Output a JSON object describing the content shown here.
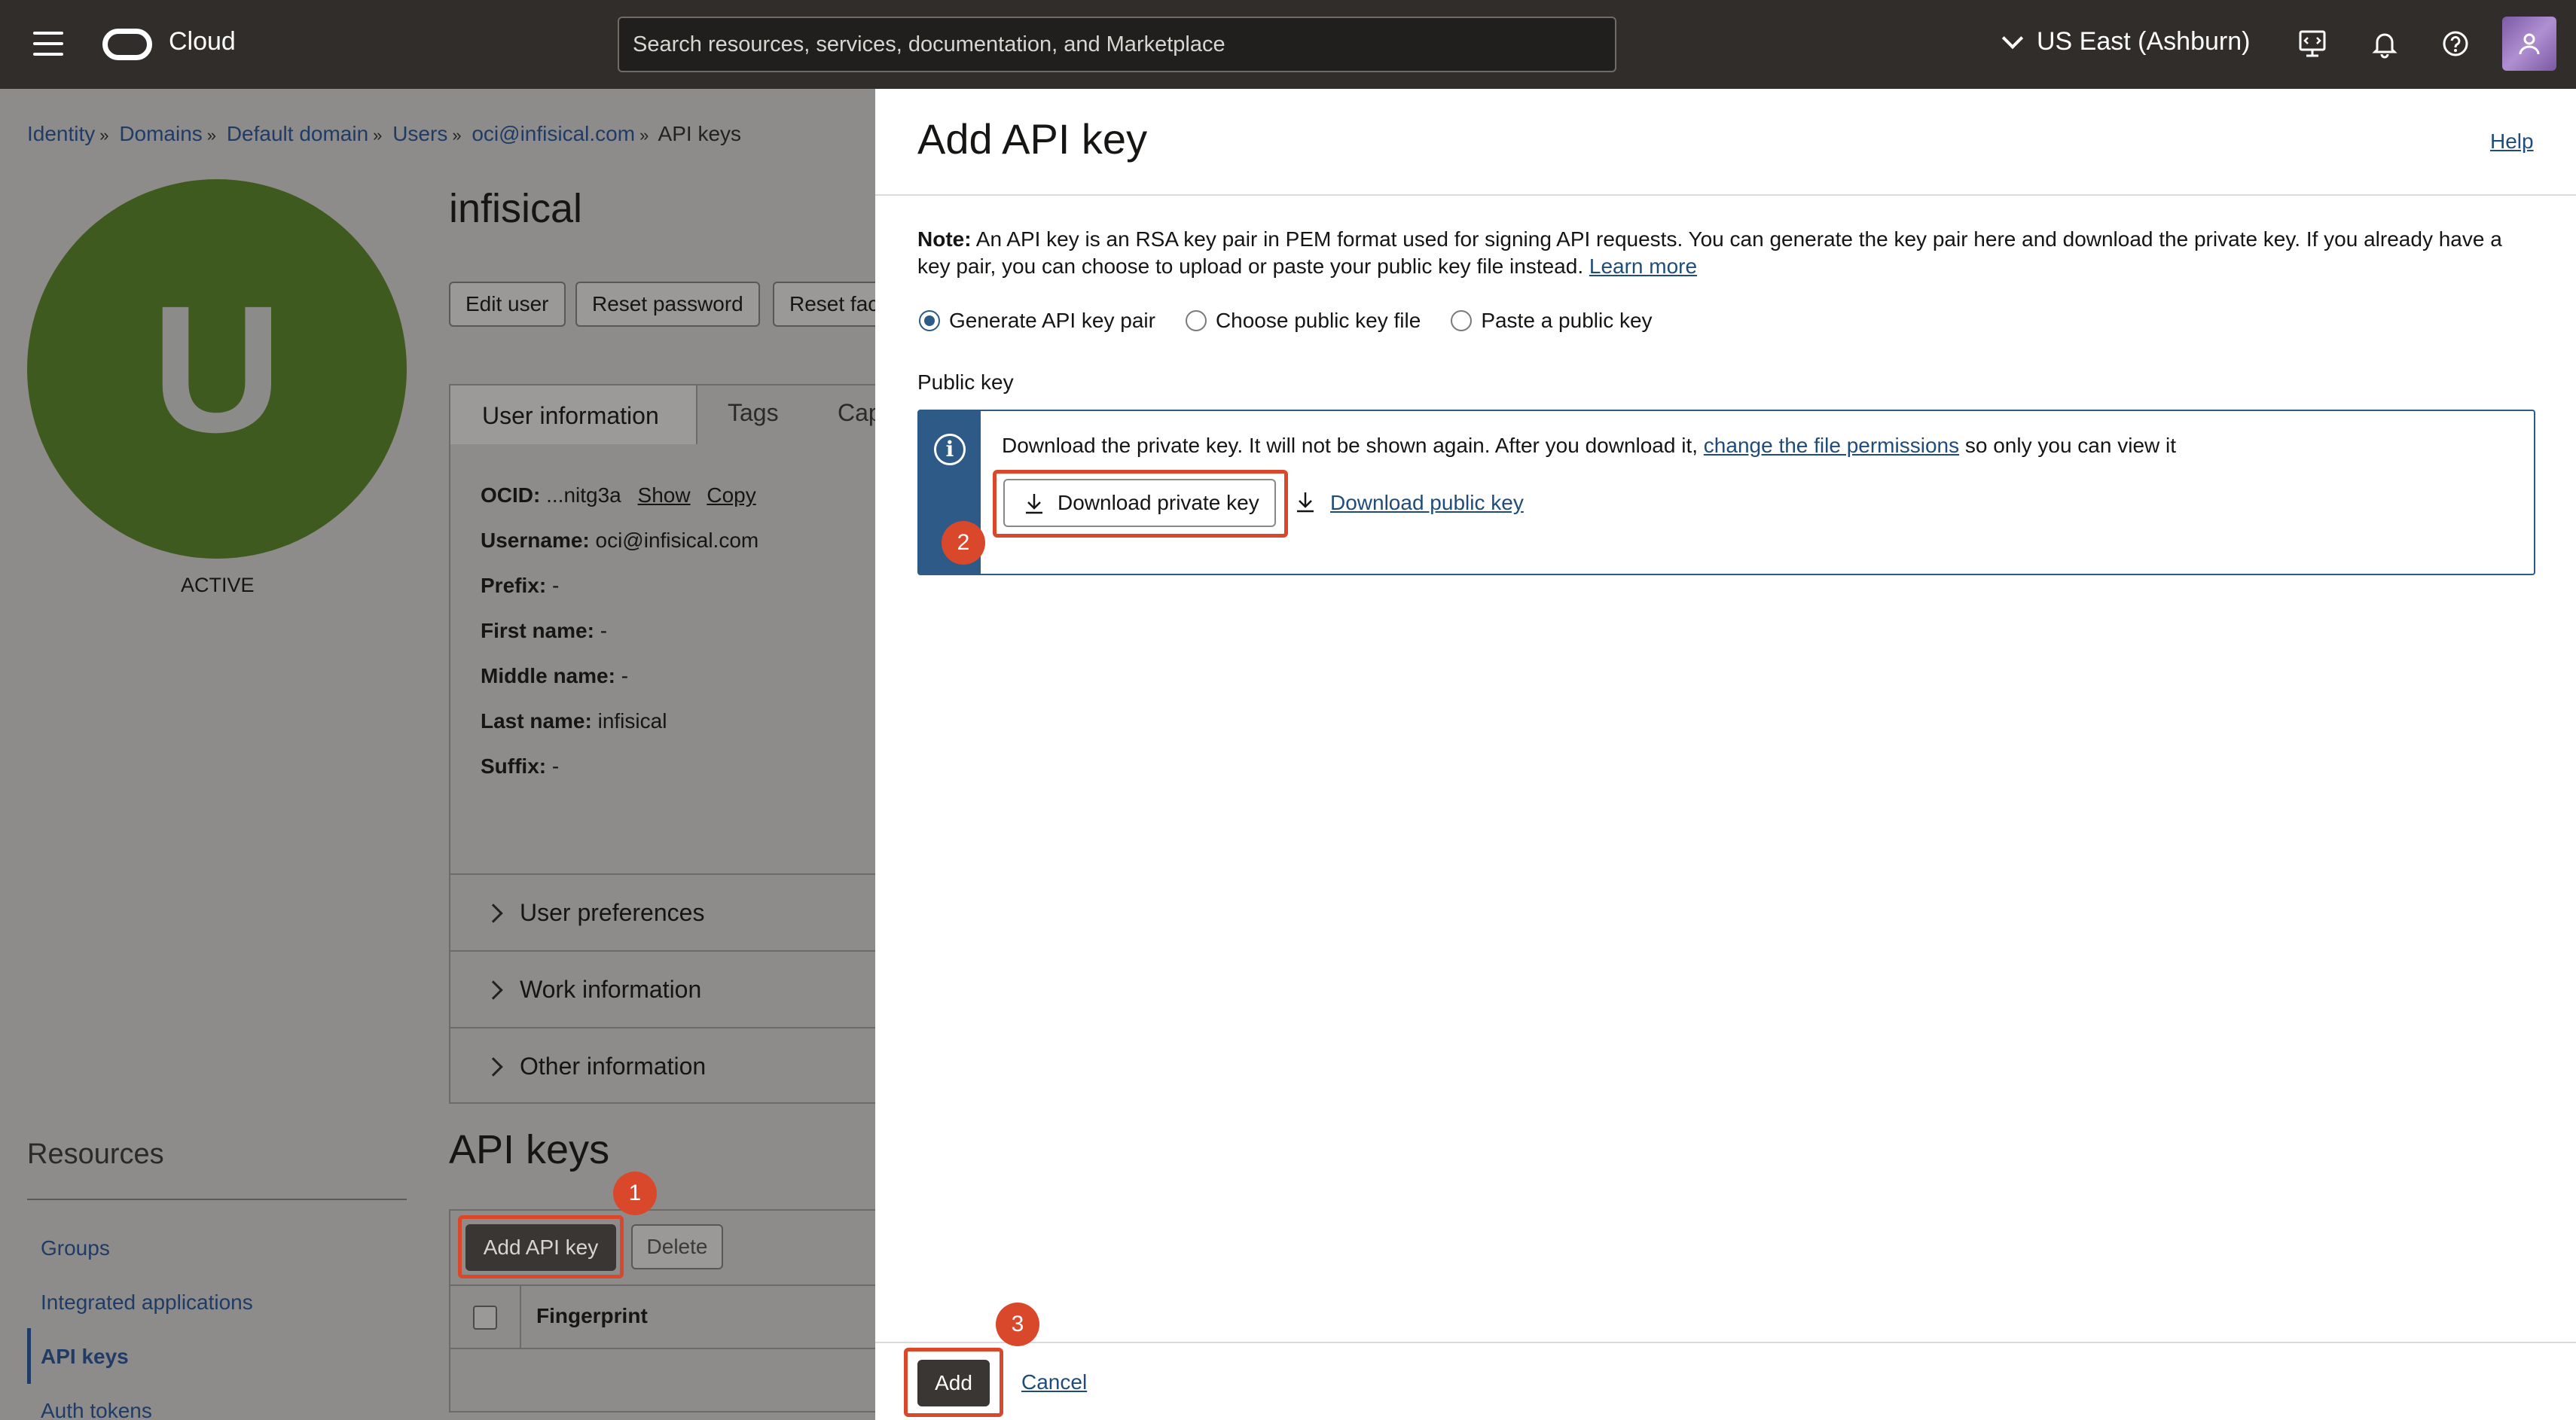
{
  "topbar": {
    "app_name": "Cloud",
    "search_placeholder": "Search resources, services, documentation, and Marketplace",
    "region": "US East (Ashburn)"
  },
  "breadcrumb": {
    "items": [
      "Identity",
      "Domains",
      "Default domain",
      "Users",
      "oci@infisical.com"
    ],
    "current": "API keys"
  },
  "user": {
    "avatar_letter": "U",
    "status": "ACTIVE",
    "name": "infisical",
    "buttons": [
      "Edit user",
      "Reset password",
      "Reset fac"
    ],
    "tabs": [
      "User information",
      "Tags",
      "Cap"
    ],
    "ocid_label": "OCID:",
    "ocid_value": "...nitg3a",
    "show": "Show",
    "copy": "Copy",
    "fields": [
      {
        "label": "Username:",
        "value": "oci@infisical.com"
      },
      {
        "label": "Prefix:",
        "value": "-"
      },
      {
        "label": "First name:",
        "value": "-"
      },
      {
        "label": "Middle name:",
        "value": "-"
      },
      {
        "label": "Last name:",
        "value": "infisical"
      },
      {
        "label": "Suffix:",
        "value": "-"
      }
    ],
    "sections": [
      "User preferences",
      "Work information",
      "Other information"
    ]
  },
  "resources": {
    "title": "Resources",
    "items": [
      "Groups",
      "Integrated applications",
      "API keys",
      "Auth tokens"
    ]
  },
  "api_keys": {
    "title": "API keys",
    "add_button": "Add API key",
    "delete_button": "Delete",
    "col_fingerprint": "Fingerprint"
  },
  "drawer": {
    "title": "Add API key",
    "help": "Help",
    "note_label": "Note:",
    "note_text": " An API key is an RSA key pair in PEM format used for signing API requests. You can generate the key pair here and download the private key. If you already have a key pair, you can choose to upload or paste your public key file instead. ",
    "learn_more": "Learn more",
    "radio_options": [
      "Generate API key pair",
      "Choose public key file",
      "Paste a public key"
    ],
    "public_key_label": "Public key",
    "info_text_1": "Download the private key. It will not be shown again. After you download it, ",
    "info_link": "change the file permissions",
    "info_text_2": " so only you can view it",
    "download_private": "Download private key",
    "download_public": "Download public key",
    "add_button": "Add",
    "cancel": "Cancel"
  },
  "annotations": [
    "1",
    "2",
    "3"
  ],
  "colors": {
    "topbar": "#312d2a",
    "accent": "#2d5a86",
    "highlight": "#d9482b",
    "avatar_bg": "#3f5a1e"
  }
}
